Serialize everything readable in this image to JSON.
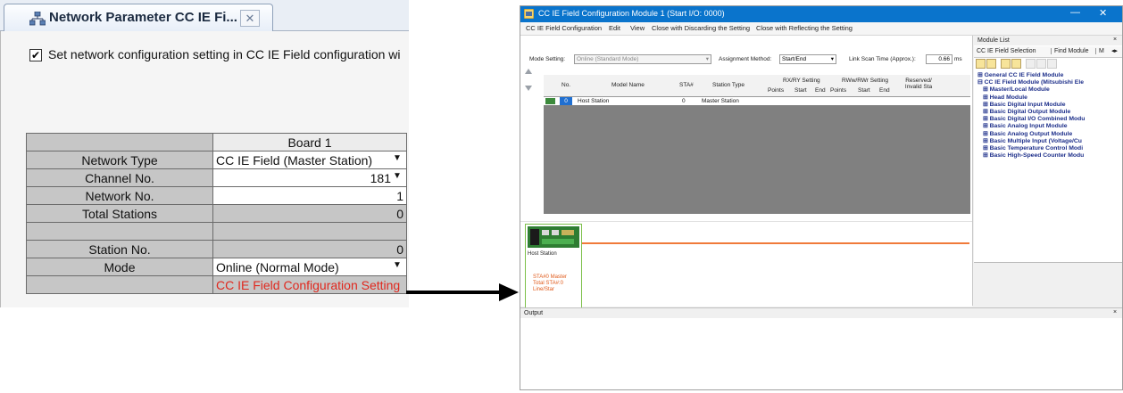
{
  "left_panel": {
    "tab_title": "Network Parameter CC IE Fi...",
    "tab_close": "✕",
    "checkbox_mark": "✔",
    "checkbox_label": "Set network configuration setting in CC IE Field configuration wi",
    "grid": {
      "header": "Board 1",
      "rows": [
        {
          "label": "Network Type",
          "value": "CC IE Field (Master Station)"
        },
        {
          "label": "Channel No.",
          "value": "181"
        },
        {
          "label": "Network No.",
          "value": "1"
        },
        {
          "label": "Total Stations",
          "value": "0"
        },
        {
          "label": "",
          "value": ""
        },
        {
          "label": "Station No.",
          "value": "0"
        },
        {
          "label": "Mode",
          "value": "Online (Normal Mode)"
        },
        {
          "label": "",
          "value": "CC IE Field Configuration Setting"
        }
      ]
    }
  },
  "window": {
    "title": "CC IE Field Configuration Module 1 (Start I/O: 0000)",
    "minimize": "—",
    "close": "✕",
    "menu": [
      "CC IE Field Configuration",
      "Edit",
      "View",
      "Close with Discarding the Setting",
      "Close with Reflecting the Setting"
    ],
    "settings": {
      "mode_label": "Mode Setting:",
      "mode_value": "Online (Standard Mode)",
      "assign_label": "Assignment Method:",
      "assign_value": "Start/End",
      "scan_label": "Link Scan Time (Approx.):",
      "scan_value": "0.66",
      "scan_unit": "ms"
    },
    "table": {
      "headers": {
        "no": "No.",
        "model": "Model Name",
        "sta": "STA#",
        "station_type": "Station Type",
        "rxry": "RX/RY Setting",
        "rwwrwr": "RWw/RWr Setting",
        "reserved": "Reserved/ Invalid Sta",
        "points": "Points",
        "start": "Start",
        "end": "End"
      },
      "rows": [
        {
          "no": "0",
          "model": "Host Station",
          "sta": "0",
          "station_type": "Master Station"
        }
      ]
    },
    "network": {
      "host_label": "Host Station",
      "info": [
        "STA#0  Master",
        "Total STA#:0",
        "Line/Star"
      ]
    },
    "module_list": {
      "title": "Module List",
      "close": "×",
      "tabs": [
        "CC IE Field Selection",
        "Find Module",
        "M"
      ],
      "tree": [
        "General CC IE Field Module",
        "CC IE Field Module (Mitsubishi Ele",
        "Master/Local Module",
        "Head Module",
        "Basic Digital Input Module",
        "Basic Digital Output Module",
        "Basic Digital I/O Combined Modu",
        "Basic Analog Input Module",
        "Basic Analog Output Module",
        "Basic Multiple Input (Voltage/Cu",
        "Basic Temperature Control Modi",
        "Basic High-Speed Counter Modu"
      ]
    },
    "output": {
      "title": "Output",
      "close": "×"
    }
  },
  "colors": {
    "title_bar": "#0a74cc",
    "tree_text": "#1d2f8a",
    "network_line": "#f07a3a",
    "host_border": "#7cc04a",
    "config_link": "#e0281e"
  }
}
